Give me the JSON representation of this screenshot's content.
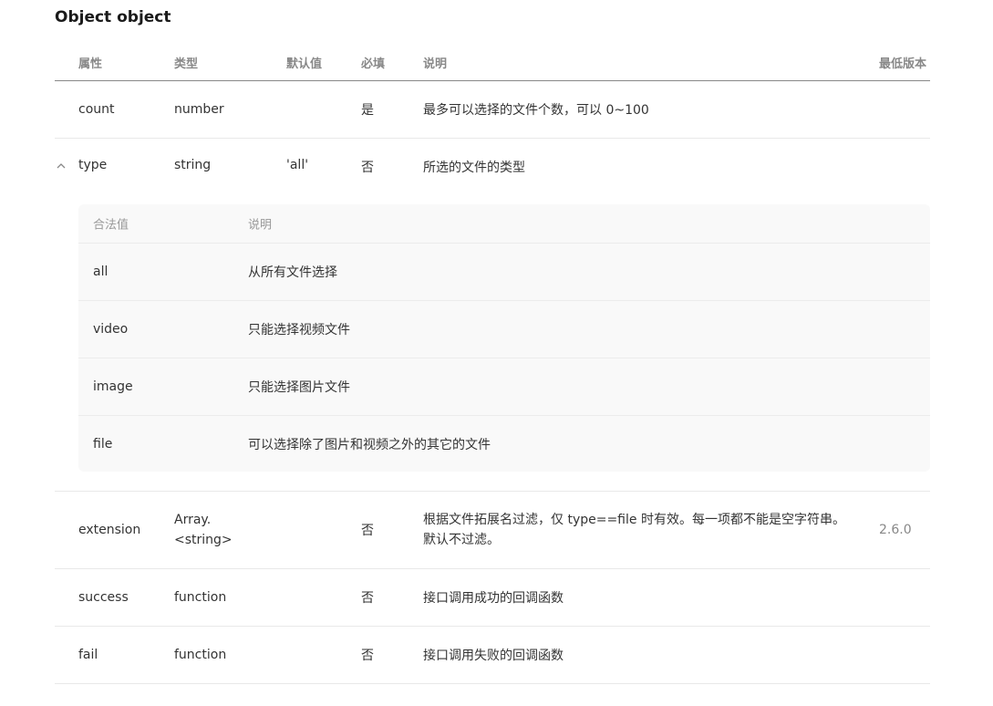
{
  "title": "Object object",
  "headers": {
    "prop": "属性",
    "type": "类型",
    "default": "默认值",
    "required": "必填",
    "desc": "说明",
    "version": "最低版本"
  },
  "rows": [
    {
      "prop": "count",
      "type": "number",
      "default": "",
      "required": "是",
      "desc": "最多可以选择的文件个数，可以 0~100",
      "version": ""
    },
    {
      "prop": "type",
      "type": "string",
      "default": "'all'",
      "required": "否",
      "desc": "所选的文件的类型",
      "version": "",
      "expanded": true,
      "collapse_icon": "chevron-up-icon"
    },
    {
      "prop": "extension",
      "type": "Array.<string>",
      "type_line1": "Array.",
      "type_line2": "<string>",
      "default": "",
      "required": "否",
      "desc": "根据文件拓展名过滤，仅 type==file 时有效。每一项都不能是空字符串。默认不过滤。",
      "desc_line1": "根据文件拓展名过滤，仅 type==file 时有效。每一项都不能是空字符串。",
      "desc_line2": "默认不过滤。",
      "version": "2.6.0"
    },
    {
      "prop": "success",
      "type": "function",
      "default": "",
      "required": "否",
      "desc": "接口调用成功的回调函数",
      "version": ""
    },
    {
      "prop": "fail",
      "type": "function",
      "default": "",
      "required": "否",
      "desc": "接口调用失败的回调函数",
      "version": ""
    }
  ],
  "type_values": {
    "headers": {
      "value": "合法值",
      "desc": "说明"
    },
    "rows": [
      {
        "value": "all",
        "desc": "从所有文件选择"
      },
      {
        "value": "video",
        "desc": "只能选择视频文件"
      },
      {
        "value": "image",
        "desc": "只能选择图片文件"
      },
      {
        "value": "file",
        "desc": "可以选择除了图片和视频之外的其它的文件"
      }
    ]
  }
}
